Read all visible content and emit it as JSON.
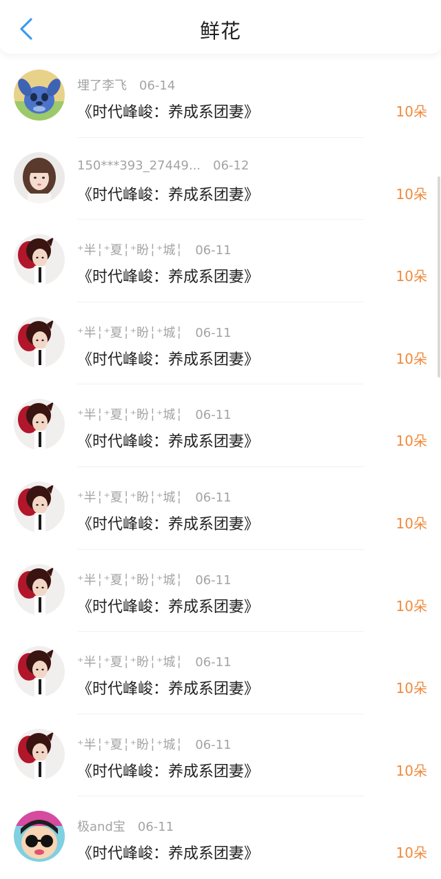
{
  "header": {
    "title": "鲜花",
    "back_icon": "chevron-left-icon"
  },
  "colors": {
    "accent": "#3b9bf0",
    "amount": "#f08a3c",
    "meta": "#a3a3a3",
    "title": "#222222"
  },
  "records": [
    {
      "user": "埋了李飞",
      "date": "06-14",
      "title": "《时代峰峻：养成系团妻》",
      "amount": "10朵",
      "avatar": "blue-creature"
    },
    {
      "user": "150***393_27449...",
      "date": "06-12",
      "title": "《时代峰峻：养成系团妻》",
      "amount": "10朵",
      "avatar": "girl"
    },
    {
      "user": "⁺半╎⁺夏╎⁺盼╎⁺城╎",
      "date": "06-11",
      "title": "《时代峰峻：养成系团妻》",
      "amount": "10朵",
      "avatar": "boy-red"
    },
    {
      "user": "⁺半╎⁺夏╎⁺盼╎⁺城╎",
      "date": "06-11",
      "title": "《时代峰峻：养成系团妻》",
      "amount": "10朵",
      "avatar": "boy-red"
    },
    {
      "user": "⁺半╎⁺夏╎⁺盼╎⁺城╎",
      "date": "06-11",
      "title": "《时代峰峻：养成系团妻》",
      "amount": "10朵",
      "avatar": "boy-red"
    },
    {
      "user": "⁺半╎⁺夏╎⁺盼╎⁺城╎",
      "date": "06-11",
      "title": "《时代峰峻：养成系团妻》",
      "amount": "10朵",
      "avatar": "boy-red"
    },
    {
      "user": "⁺半╎⁺夏╎⁺盼╎⁺城╎",
      "date": "06-11",
      "title": "《时代峰峻：养成系团妻》",
      "amount": "10朵",
      "avatar": "boy-red"
    },
    {
      "user": "⁺半╎⁺夏╎⁺盼╎⁺城╎",
      "date": "06-11",
      "title": "《时代峰峻：养成系团妻》",
      "amount": "10朵",
      "avatar": "boy-red"
    },
    {
      "user": "⁺半╎⁺夏╎⁺盼╎⁺城╎",
      "date": "06-11",
      "title": "《时代峰峻：养成系团妻》",
      "amount": "10朵",
      "avatar": "boy-red"
    },
    {
      "user": "极and宝",
      "date": "06-11",
      "title": "《时代峰峻：养成系团妻》",
      "amount": "10朵",
      "avatar": "tnt-cartoon"
    }
  ]
}
